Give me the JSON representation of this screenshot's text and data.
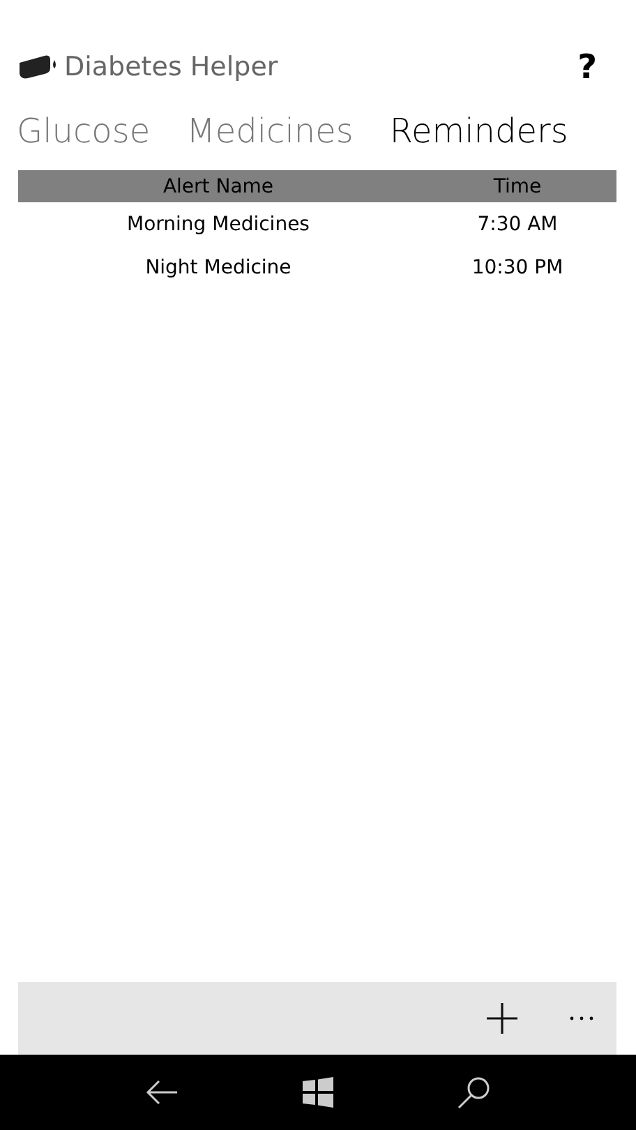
{
  "app": {
    "title": "Diabetes Helper",
    "help": "?"
  },
  "tabs": [
    {
      "label": "Glucose",
      "selected": false
    },
    {
      "label": "Medicines",
      "selected": false
    },
    {
      "label": "Reminders",
      "selected": true
    }
  ],
  "table": {
    "columns": [
      "Alert Name",
      "Time"
    ],
    "rows": [
      [
        "Morning Medicines",
        "7:30 AM"
      ],
      [
        "Night Medicine",
        "10:30 PM"
      ]
    ]
  }
}
